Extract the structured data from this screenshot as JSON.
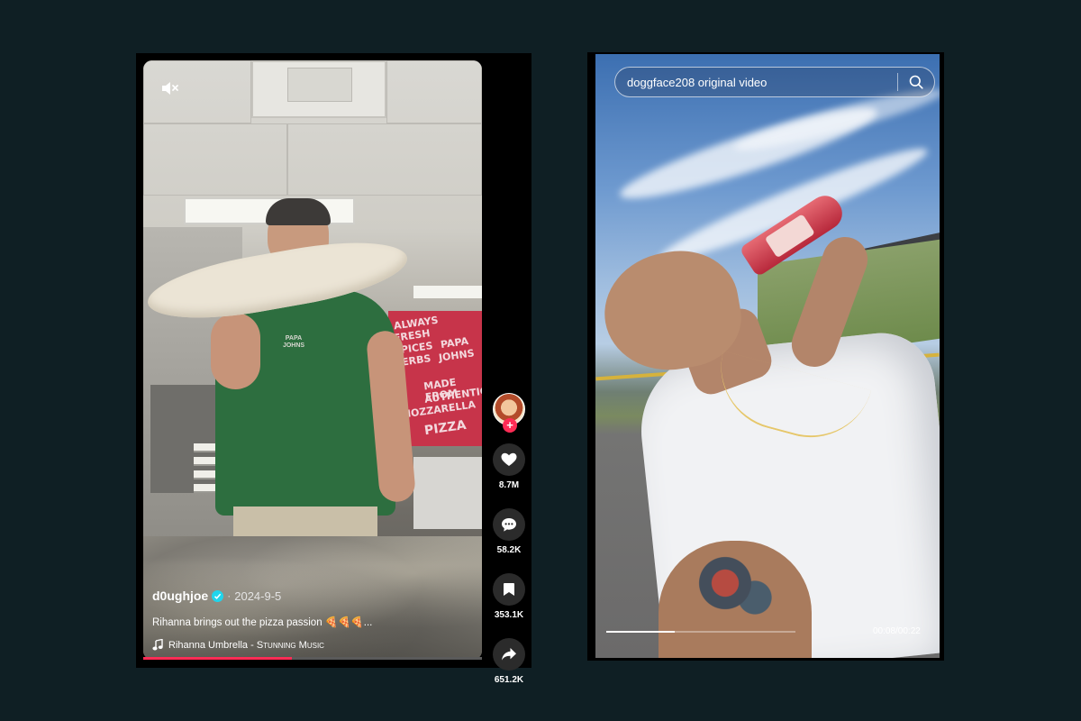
{
  "left_video": {
    "author": "d0ughjoe",
    "date": "2024-9-5",
    "date_separator": "·",
    "caption": "Rihanna brings out the pizza passion 🍕🍕🍕...",
    "music_artist": "Rihanna Umbrella - ",
    "music_label": "Stunning Music",
    "progress_fraction": 0.44,
    "mute_icon": "volume-muted-icon",
    "actions": {
      "follow_symbol": "+",
      "likes": "8.7M",
      "comments": "58.2K",
      "saves": "353.1K",
      "shares": "651.2K"
    },
    "wall_text": [
      "ALWAYS",
      "FRESH",
      "SPICES",
      "HERBS",
      "PAPA",
      "JOHNS",
      "MADE FROM",
      "AUTHENTIC",
      "MOZZARELLA",
      "PIZZA"
    ],
    "shirt_logo": "PAPA JOHNS"
  },
  "right_video": {
    "search_text": "doggface208 original video",
    "search_icon": "search-icon",
    "time": "00:08/00:22",
    "progress_fraction": 0.36
  },
  "colors": {
    "background": "#0f1f24",
    "accent": "#fe2c55",
    "verified": "#20d5ec"
  }
}
